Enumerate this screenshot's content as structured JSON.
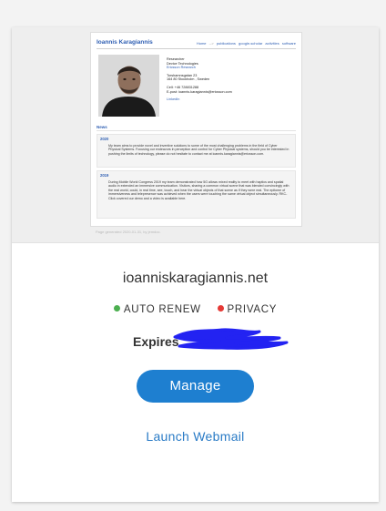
{
  "preview": {
    "site_name": "Ioannis Karagiannis",
    "nav": [
      "Home",
      "publications",
      "google-scholar",
      "activities",
      "software"
    ],
    "nav_separator": "-->",
    "info_lines": [
      "Researcher",
      "Device Technologies",
      "Ericsson Research",
      "Torshamnsgatan 23",
      "164 80 Stockholm , Sweden",
      "Cell: +46 728831288",
      "E-post: ioannis.karagiannis@ericsson.com",
      "LinkedIn"
    ],
    "news_heading": "News",
    "news": [
      {
        "year": "2020",
        "text": "My team aims to provide novel and inventive solutions to some of the most challenging problems in the field of Cyber Physical Systems. Focusing our endeavors in perception and control for Cyber Physical systems, should you be interested in pushing the limits of technology, please do not hesitate to contact me at ioannis.karagiannis@ericsson.com."
      },
      {
        "year": "2019",
        "text": "During Mobile World Congress 2019 my team demonstrated how 5G allows mixed reality to meet with haptics and spatial audio in extended an immersive communication. Visitors, sharing a common virtual scene that was blended convincingly with the real world, could, in real time, see, touch, and hear the virtual objects of that scene as if they were real. The epitome of immersiveness and telepresence was achieved when the users were touching the same virtual object simultaneously. RKC-Click covered our demo and a video is available here."
      }
    ],
    "footer": "Page generated 2020-01-31, by jemdoc."
  },
  "domain_name": "ioanniskaragiannis.net",
  "auto_renew_label": "AUTO RENEW",
  "privacy_label": "PRIVACY",
  "auto_renew_color": "#4caf50",
  "privacy_color": "#e53935",
  "expires_label": "Expires",
  "manage_label": "Manage",
  "webmail_label": "Launch Webmail",
  "accent_color": "#1e7fd0",
  "redaction_color": "#2323f2"
}
